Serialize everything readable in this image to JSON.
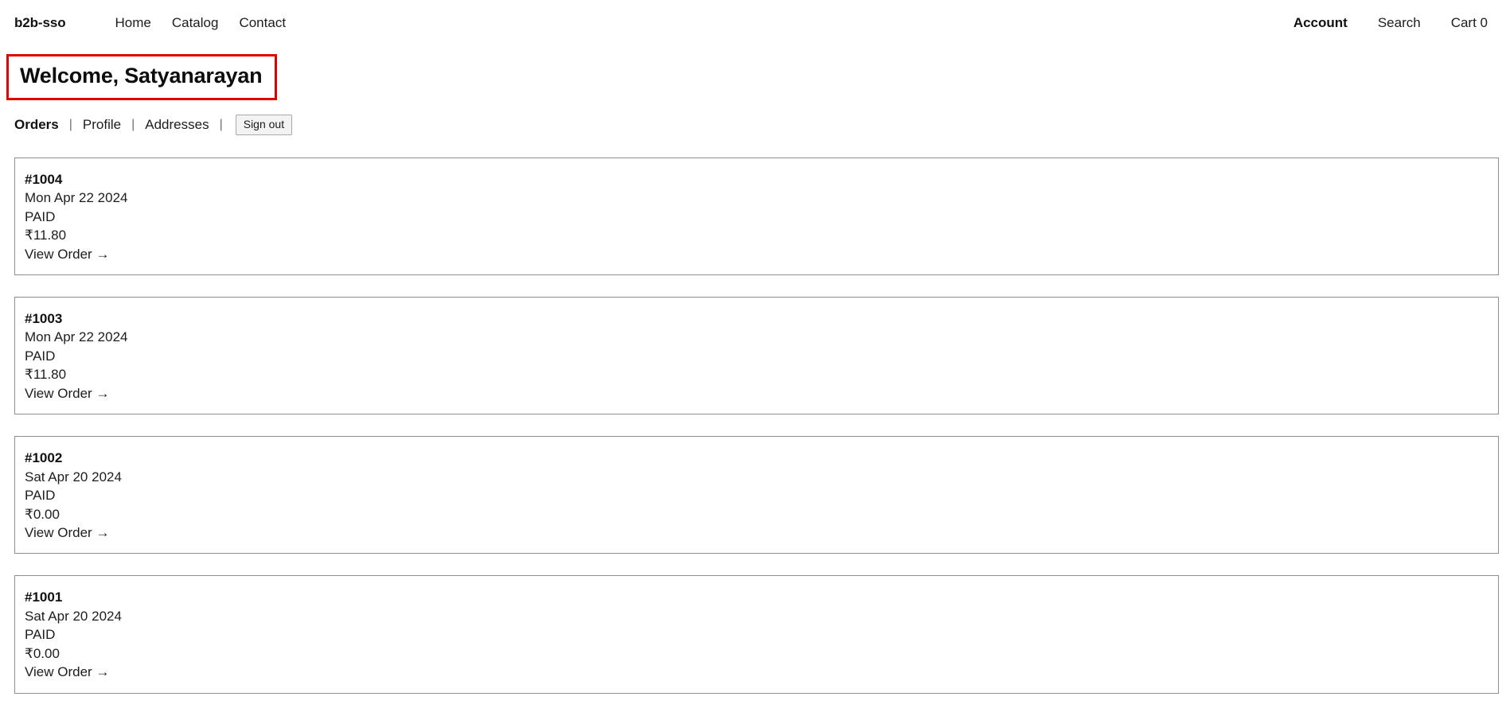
{
  "header": {
    "brand": "b2b-sso",
    "nav": [
      {
        "label": "Home"
      },
      {
        "label": "Catalog"
      },
      {
        "label": "Contact"
      }
    ],
    "utility": [
      {
        "label": "Account",
        "active": true
      },
      {
        "label": "Search",
        "active": false
      },
      {
        "label": "Cart 0",
        "active": false
      }
    ]
  },
  "page": {
    "heading": "Welcome, Satyanarayan",
    "annotation_color": "#e00000"
  },
  "account_nav": {
    "items": [
      {
        "label": "Orders",
        "active": true
      },
      {
        "label": "Profile",
        "active": false
      },
      {
        "label": "Addresses",
        "active": false
      }
    ],
    "separator": "|",
    "signout_label": "Sign out"
  },
  "orders": {
    "view_order_label": "View Order →",
    "items": [
      {
        "number": "#1004",
        "date": "Mon Apr 22 2024",
        "status": "PAID",
        "total": "₹11.80",
        "link": "View Order →"
      },
      {
        "number": "#1003",
        "date": "Mon Apr 22 2024",
        "status": "PAID",
        "total": "₹11.80",
        "link": "View Order →"
      },
      {
        "number": "#1002",
        "date": "Sat Apr 20 2024",
        "status": "PAID",
        "total": "₹0.00",
        "link": "View Order →"
      },
      {
        "number": "#1001",
        "date": "Sat Apr 20 2024",
        "status": "PAID",
        "total": "₹0.00",
        "link": "View Order →"
      }
    ]
  }
}
